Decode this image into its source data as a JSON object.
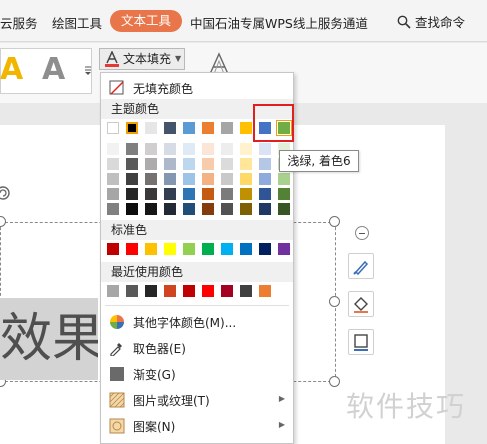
{
  "tabs": {
    "cloud_service": "云服务",
    "drawing_tools": "绘图工具",
    "text_tools": "文本工具",
    "petrochina": "中国石油专属WPS线上服务通道",
    "search": "查找命令"
  },
  "ribbon": {
    "text_fill_button": "文本填充"
  },
  "menu": {
    "no_fill": "无填充颜色",
    "theme_colors_header": "主题颜色",
    "standard_colors_header": "标准色",
    "recent_colors_header": "最近使用颜色",
    "other_colors": "其他字体颜色(M)...",
    "eyedropper": "取色器(E)",
    "gradient": "渐变(G)",
    "picture_texture": "图片或纹理(T)",
    "pattern": "图案(N)",
    "theme_top_row": [
      "#ffffff",
      "#000000",
      "#e7e6e6",
      "#44546a",
      "#5b9bd5",
      "#ed7d31",
      "#a5a5a5",
      "#ffc000",
      "#4472c4",
      "#70ad47"
    ],
    "theme_shades": [
      [
        "#f2f2f2",
        "#7f7f7f",
        "#d0cece",
        "#d6dce5",
        "#deebf7",
        "#fbe5d6",
        "#ededed",
        "#fff2cc",
        "#dae3f3",
        "#e2f0d9"
      ],
      [
        "#d9d9d9",
        "#595959",
        "#aeabab",
        "#adb9ca",
        "#bdd7ee",
        "#f8cbad",
        "#dbdbdb",
        "#ffe699",
        "#b4c7e7",
        "#c5e0b4"
      ],
      [
        "#bfbfbf",
        "#404040",
        "#757171",
        "#8497b0",
        "#9dc3e6",
        "#f4b183",
        "#c9c9c9",
        "#ffd966",
        "#8faadc",
        "#a9d18e"
      ],
      [
        "#a6a6a6",
        "#262626",
        "#3a3838",
        "#333f50",
        "#2e75b6",
        "#c55a11",
        "#7b7b7b",
        "#bf9000",
        "#2f5597",
        "#548235"
      ],
      [
        "#808080",
        "#0d0d0d",
        "#171616",
        "#222a35",
        "#1f4e79",
        "#843c0c",
        "#525252",
        "#7f6000",
        "#203864",
        "#375623"
      ]
    ],
    "standard": [
      "#c00000",
      "#ff0000",
      "#ffc000",
      "#ffff00",
      "#92d050",
      "#00b050",
      "#00b0f0",
      "#0070c0",
      "#002060",
      "#7030a0"
    ],
    "recent": [
      "#a6a6a6",
      "#595959",
      "#262626",
      "#d0441f",
      "#c00000",
      "#ff0000",
      "#a50021",
      "#404040",
      "#ed7d31"
    ]
  },
  "tooltip": "浅绿, 着色6",
  "canvas": {
    "big_text": "效果",
    "watermark": "软件技巧"
  }
}
